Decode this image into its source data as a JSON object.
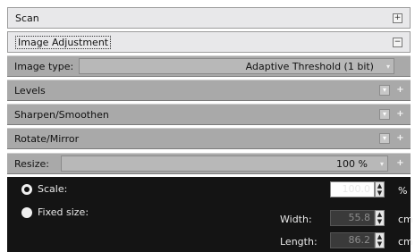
{
  "sections": {
    "scan": {
      "label": "Scan",
      "toggle": "+"
    },
    "image_adjustment": {
      "label": "Image Adjustment",
      "toggle": "−"
    }
  },
  "image_type": {
    "label": "Image type:",
    "value": "Adaptive Threshold (1 bit)",
    "chevron": "▾"
  },
  "rows": {
    "levels": {
      "label": "Levels"
    },
    "sharpen": {
      "label": "Sharpen/Smoothen"
    },
    "rotate": {
      "label": "Rotate/Mirror"
    }
  },
  "resize": {
    "label": "Resize:",
    "value": "100 %"
  },
  "mini": {
    "drop": "▾",
    "plus": "+"
  },
  "scale": {
    "label": "Scale:",
    "value": "100.0",
    "unit": "%",
    "selected": true
  },
  "fixed_size": {
    "label": "Fixed size:",
    "width_label": "Width:",
    "width_value": "55.8",
    "width_unit": "cm",
    "length_label": "Length:",
    "length_value": "86.2",
    "length_unit": "cm"
  },
  "spin": {
    "up": "▲",
    "down": "▼"
  }
}
